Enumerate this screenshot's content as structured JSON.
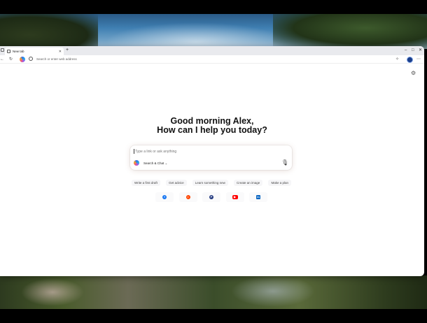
{
  "browser": {
    "tab_title": "New tab",
    "new_tab_label": "+",
    "address_placeholder": "Search or enter web address",
    "window_controls": [
      "–",
      "□",
      "✕"
    ]
  },
  "icons": {
    "sidebar": "sidebar-icon",
    "close_tab": "✕",
    "back": "←",
    "refresh": "↻",
    "search": "search-icon",
    "extensions": "✧",
    "more": "⋯",
    "settings": "⚙",
    "mic": "🎙",
    "chevron": "⌄"
  },
  "main": {
    "greeting_line1": "Good morning Alex,",
    "greeting_line2": "How can I help you today?",
    "prompt_placeholder": "Type a link or ask anything",
    "mode_label": "Search & Chat",
    "mode_chevron": "⌄",
    "chips": [
      "Write a first draft",
      "Get advice",
      "Learn something new",
      "Create an image",
      "Make a plan"
    ],
    "shortcuts": [
      {
        "name": "facebook",
        "glyph": "f",
        "color": "#1877f2"
      },
      {
        "name": "reddit",
        "glyph": "r",
        "color": "#ff4500"
      },
      {
        "name": "paypal",
        "glyph": "P",
        "color": "#253b80"
      },
      {
        "name": "youtube",
        "glyph": "▶",
        "color": "#ff0000"
      },
      {
        "name": "linkedin",
        "glyph": "in",
        "color": "#0a66c2"
      }
    ]
  }
}
